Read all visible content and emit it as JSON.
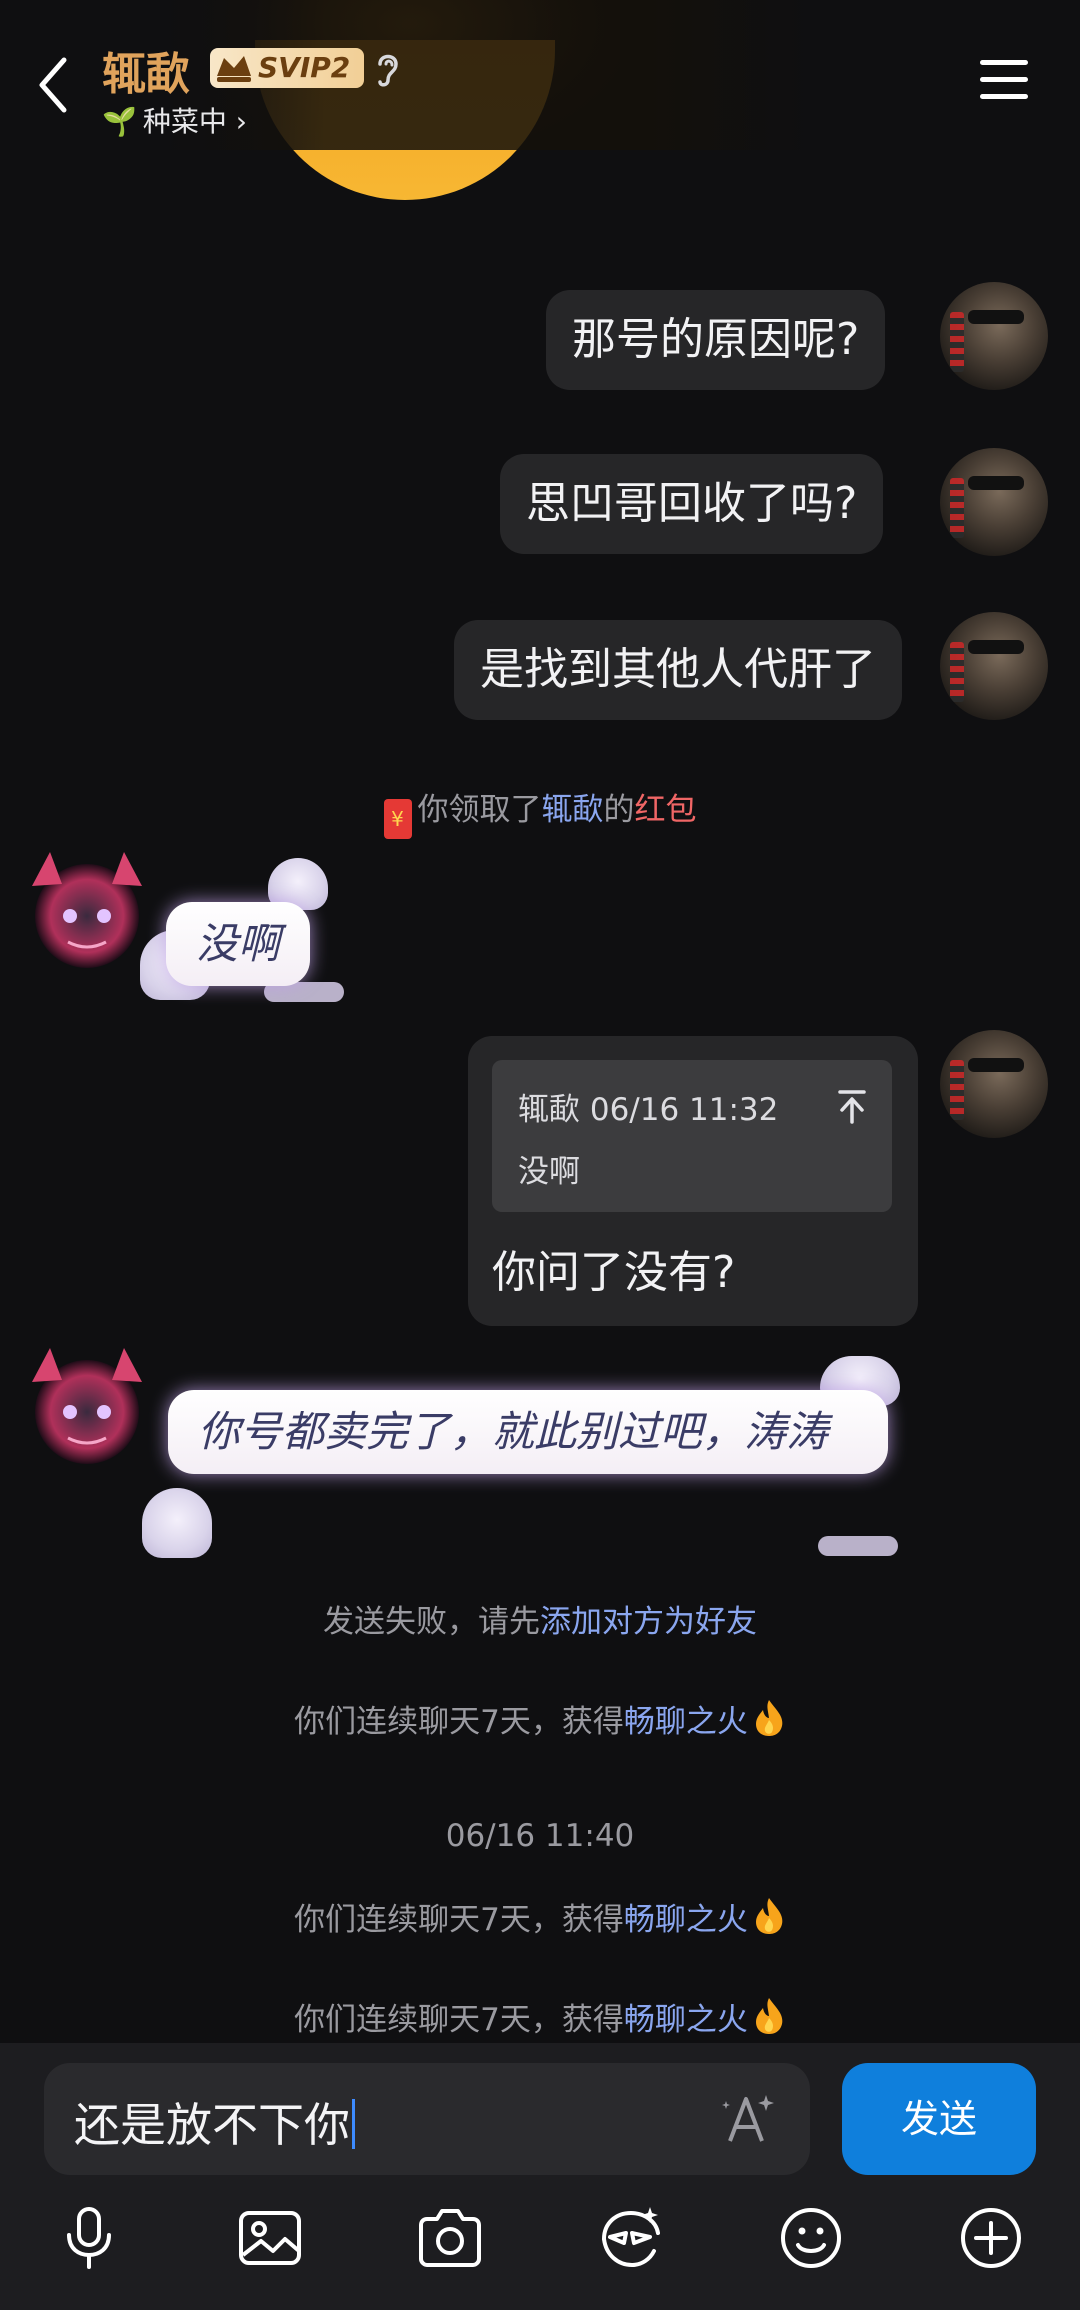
{
  "header": {
    "title": "辄歃",
    "badge": "SVIP2",
    "subtitle": "种菜中",
    "subtitle_chevron": "›",
    "icons": [
      "back-arrow-icon",
      "crown-icon",
      "hearing-icon",
      "menu-icon"
    ]
  },
  "messages": {
    "m1": "那号的原因呢?",
    "m2": "思凹哥回收了吗?",
    "m3": "是找到其他人代肝了",
    "redpacket": {
      "prefix": "你领取了",
      "sender": "辄歃",
      "middle": "的",
      "link": "红包",
      "icon_glyph": "¥"
    },
    "r1": "没啊",
    "quote": {
      "meta": "辄歃 06/16 11:32",
      "quoted": "没啊",
      "reply": "你问了没有?"
    },
    "r2": "你号都卖完了，就此别过吧，涛涛",
    "failed": {
      "prefix": "发送失败，请先",
      "link": "添加对方为好友"
    },
    "streak": {
      "prefix": "你们连续聊天7天，获得",
      "link": "畅聊之火"
    },
    "timestamp": "06/16 11:40"
  },
  "input": {
    "value": "还是放不下你",
    "send_label": "发送"
  },
  "toolbar": [
    "microphone-icon",
    "image-icon",
    "camera-icon",
    "sticker-icon",
    "emoji-icon",
    "plus-icon"
  ],
  "colors": {
    "background": "#0f0f11",
    "bubble": "#262628",
    "link": "#8aa6ef",
    "accent_send": "#0f7fdc",
    "title": "#e0a35c"
  }
}
